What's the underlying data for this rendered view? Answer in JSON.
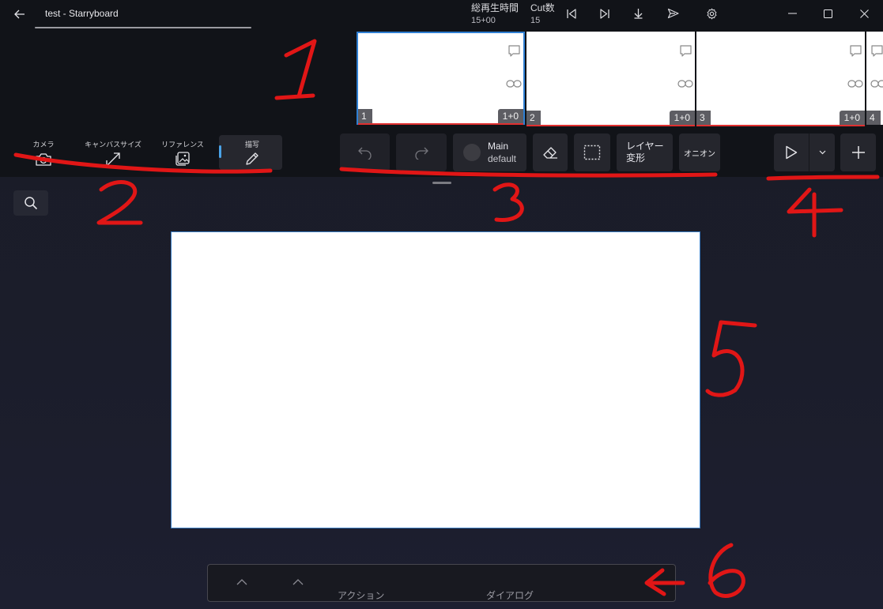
{
  "window": {
    "title": "test - Starryboard",
    "back_icon": "arrow-left-icon"
  },
  "header_stats": {
    "total_time_label": "総再生時間",
    "total_time_value": "15+00",
    "cut_count_label": "Cut数",
    "cut_count_value": "15"
  },
  "header_buttons": [
    "skip-start-icon",
    "skip-end-icon",
    "download-icon",
    "send-icon",
    "gear-icon"
  ],
  "window_controls": [
    "minimize-icon",
    "maximize-icon",
    "close-icon"
  ],
  "cuts": [
    {
      "number": "1",
      "duration": "1+0",
      "selected": true
    },
    {
      "number": "2",
      "duration": "1+0",
      "selected": false
    },
    {
      "number": "3",
      "duration": "1+0",
      "selected": false
    },
    {
      "number": "4",
      "duration": "",
      "selected": false
    }
  ],
  "left_tools": {
    "camera": "カメラ",
    "canvas_size": "キャンバスサイズ",
    "reference": "リファレンス",
    "draw": "描写"
  },
  "layer": {
    "name": "Main",
    "preset": "default"
  },
  "layer_transform_label": "レイヤー変形",
  "onion_label": "オニオン",
  "bottom_panel": {
    "action_label": "アクション",
    "dialog_label": "ダイアログ"
  },
  "annotations": [
    "1",
    "2",
    "3",
    "4",
    "5",
    "6"
  ],
  "colors": {
    "accent_blue": "#2f7fd3",
    "marker_red": "#e11616",
    "canvas": "#ffffff"
  }
}
